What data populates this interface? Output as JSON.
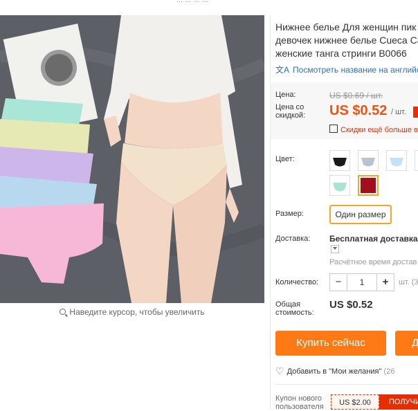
{
  "top_fragment": "... ... ... ...",
  "image": {
    "alt": "product photo",
    "zoom_hint": "Наведите курсор, чтобы увеличить"
  },
  "product": {
    "title_lines": [
      "Нижнее белье Для женщин пик",
      "девочек нижнее белье Cueca Ca",
      "женские танга стринги B0066"
    ],
    "translate_link": "Посмотреть название на английс"
  },
  "pricing": {
    "price_label": "Цена:",
    "old_price": "US $0.69 / шт.",
    "discount_label_1": "Цена со",
    "discount_label_2": "скидкой:",
    "new_price": "US $0.52",
    "per_unit": "/ шт.",
    "extra_discount": "Скидки ещё больше в"
  },
  "options": {
    "color_label": "Цвет:",
    "size_label": "Размер:",
    "size_value": "Один размер"
  },
  "shipping": {
    "label": "Доставка:",
    "value": "Бесплатная доставка в",
    "time": "Расчётное время достав"
  },
  "quantity": {
    "label": "Количество:",
    "minus": "−",
    "value": "1",
    "plus": "+",
    "unit": "шт. (3"
  },
  "total": {
    "label_1": "Общая",
    "label_2": "стоимость:",
    "value": "US $0.52"
  },
  "actions": {
    "buy_now": "Купить сейчас",
    "add_to_cart": "Д",
    "wishlist": "Добавить в \"Мои желания\"",
    "wishlist_count": "(26"
  },
  "coupon": {
    "label_1": "Купон нового",
    "label_2": "пользователя",
    "value": "US $2.00",
    "button": "ПОЛУЧИ"
  },
  "colors": {
    "accent": "#ff7a14",
    "price": "#f05213",
    "link": "#2d6fbf",
    "selected_border": "#f4a62a",
    "sale_red": "#e62e04"
  }
}
